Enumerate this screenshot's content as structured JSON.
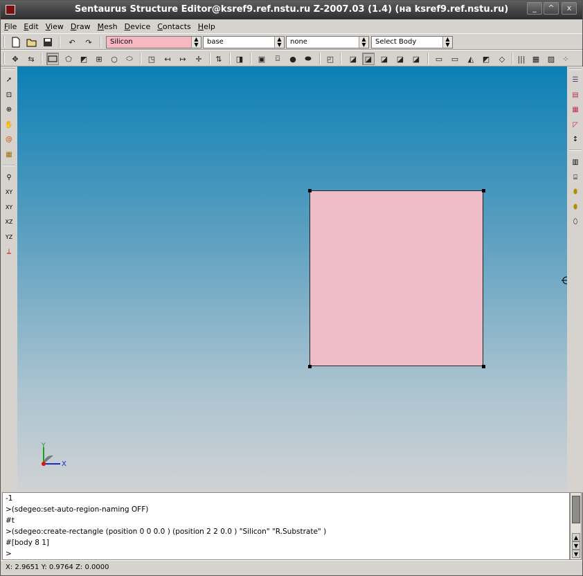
{
  "window": {
    "title": "Sentaurus Structure Editor@ksref9.ref.nstu.ru Z-2007.03 (1.4) (на ksref9.ref.nstu.ru)"
  },
  "menu": [
    "File",
    "Edit",
    "View",
    "Draw",
    "Mesh",
    "Device",
    "Contacts",
    "Help"
  ],
  "toolbar": {
    "material": {
      "value": "Silicon",
      "color": "#f7b8c2"
    },
    "region": {
      "value": "base"
    },
    "option": {
      "value": "none"
    },
    "selection": {
      "value": "Select Body"
    }
  },
  "console": {
    "lines": [
      "-1",
      ">(sdegeo:set-auto-region-naming OFF)",
      "#t",
      ">(sdegeo:create-rectangle (position 0 0 0.0 )  (position 2 2 0.0 ) \"Silicon\" \"R.Substrate\" )",
      "#[body 8 1]",
      ">"
    ]
  },
  "axes": {
    "x": "X",
    "y": "Y"
  },
  "status": {
    "coords": "X: 2.9651  Y: 0.9764  Z: 0.0000"
  },
  "viewport": {
    "background_top": "#0c7fb5",
    "background_bottom": "#cfd2d4",
    "shape_fill": "#eebcc6"
  }
}
